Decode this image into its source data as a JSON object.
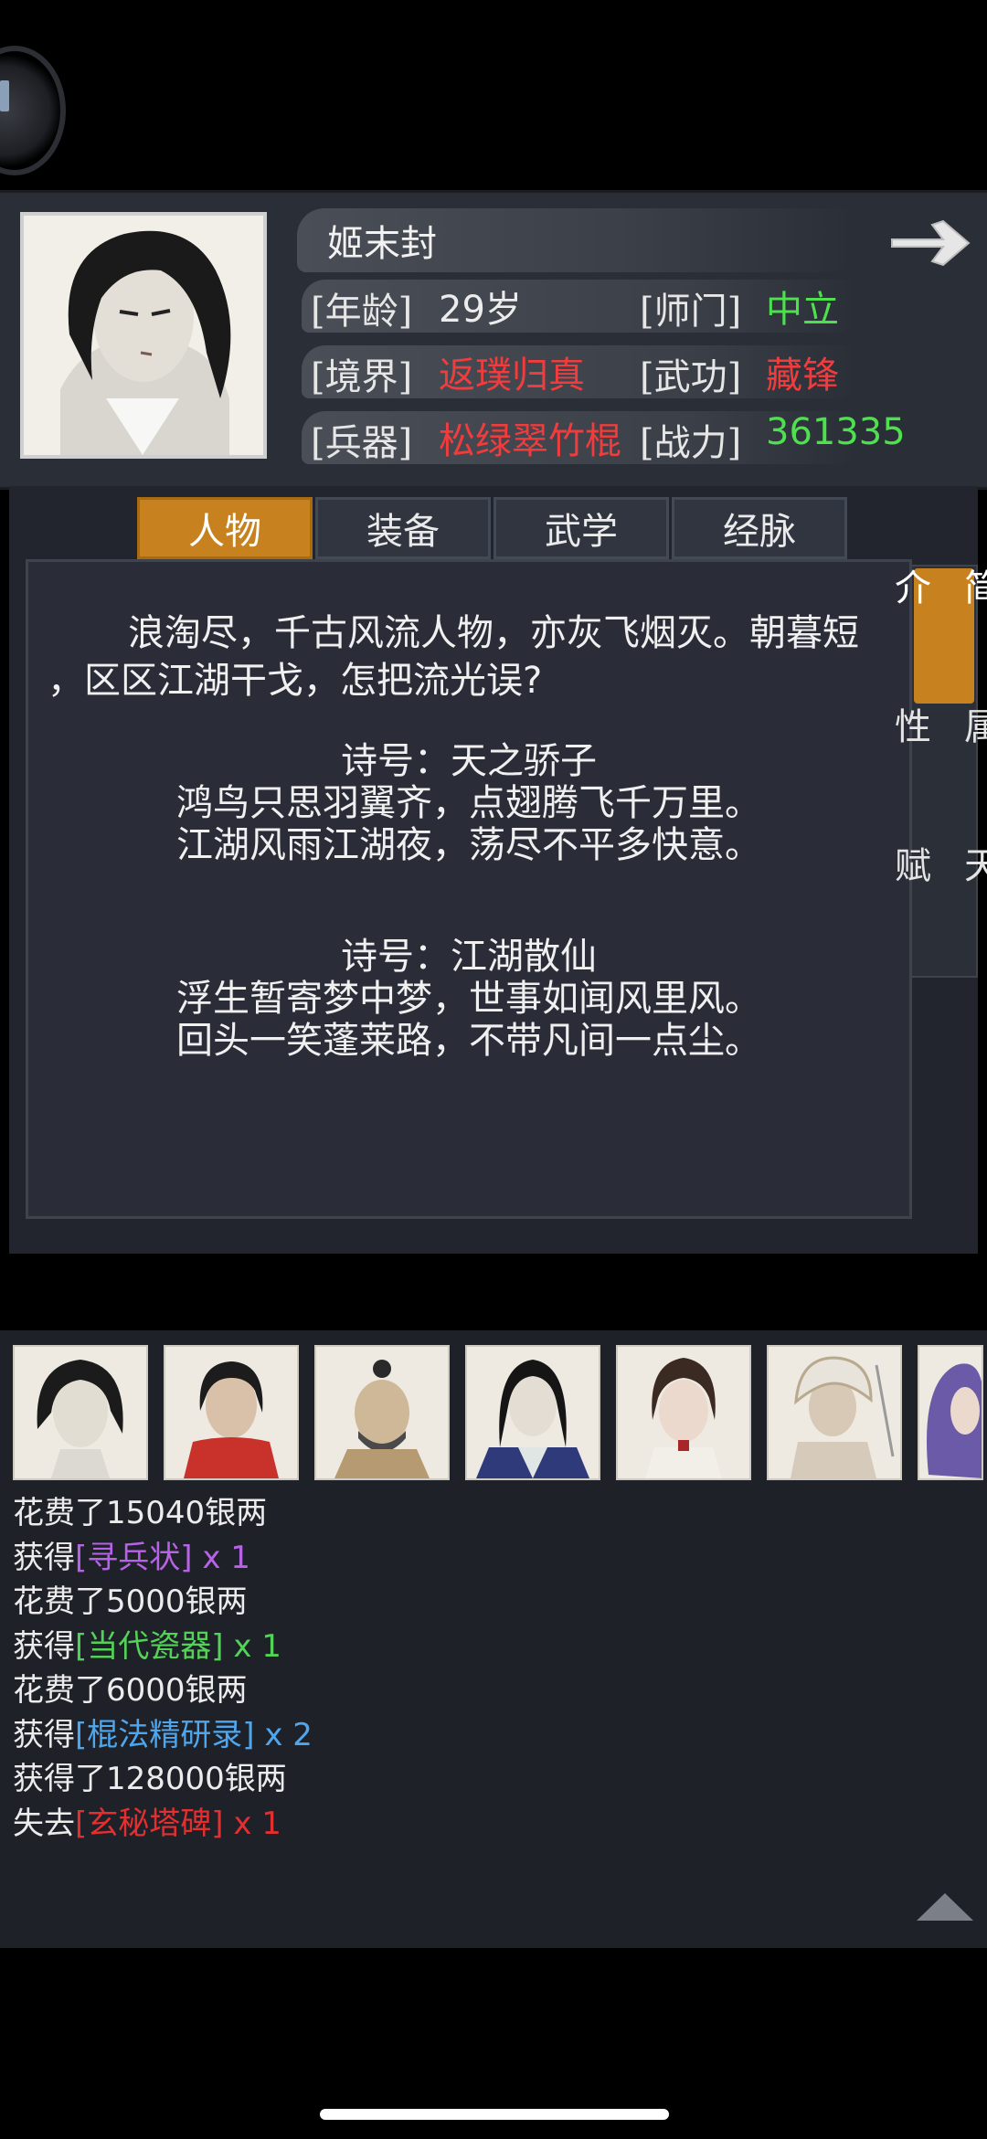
{
  "character": {
    "name": "姬末封",
    "rows": [
      {
        "label": "[年龄]",
        "value": "29岁",
        "color": "#ececec"
      },
      {
        "label": "[师门]",
        "value": "中立",
        "color": "#4fe04f"
      },
      {
        "label": "[境界]",
        "value": "返璞归真",
        "color": "#f03c3c"
      },
      {
        "label": "[武功]",
        "value": "藏锋",
        "color": "#f03c3c"
      },
      {
        "label": "[兵器]",
        "value": "松绿翠竹棍",
        "color": "#f03c3c"
      },
      {
        "label": "[战力]",
        "value": "361335",
        "color": "#4fe04f"
      }
    ]
  },
  "tabs": [
    {
      "label": "人物",
      "active": true
    },
    {
      "label": "装备",
      "active": false
    },
    {
      "label": "武学",
      "active": false
    },
    {
      "label": "经脉",
      "active": false
    }
  ],
  "side_tabs": [
    {
      "label": "简介",
      "active": true
    },
    {
      "label": "属性",
      "active": false
    },
    {
      "label": "天赋",
      "active": false
    }
  ],
  "bio": {
    "line1": "浪淘尽，千古风流人物，亦灰飞烟灭。朝暮短",
    "line2": "，区区江湖干戈，怎把流光误?",
    "poem1": {
      "title": "诗号：天之骄子",
      "l1": "鸿鸟只思羽翼齐，点翅腾飞千万里。",
      "l2": "江湖风雨江湖夜，荡尽不平多快意。"
    },
    "poem2": {
      "title": "诗号：江湖散仙",
      "l1": "浮生暂寄梦中梦，世事如闻风里风。",
      "l2": "回头一笑蓬莱路，不带凡间一点尘。"
    }
  },
  "log": [
    {
      "pre": "花费了15040银两",
      "item": "",
      "suffix": "",
      "color": ""
    },
    {
      "pre": "获得",
      "item": "[寻兵状]",
      "suffix": " x 1",
      "color": "purple"
    },
    {
      "pre": "花费了5000银两",
      "item": "",
      "suffix": "",
      "color": ""
    },
    {
      "pre": "获得",
      "item": "[当代瓷器]",
      "suffix": " x 1",
      "color": "green"
    },
    {
      "pre": "花费了6000银两",
      "item": "",
      "suffix": "",
      "color": ""
    },
    {
      "pre": "获得",
      "item": "[棍法精研录]",
      "suffix": " x 2",
      "color": "blue"
    },
    {
      "pre": "获得了128000银两",
      "item": "",
      "suffix": "",
      "color": ""
    },
    {
      "pre": "失去",
      "item": "[玄秘塔碑]",
      "suffix": " x 1",
      "color": "red"
    }
  ]
}
